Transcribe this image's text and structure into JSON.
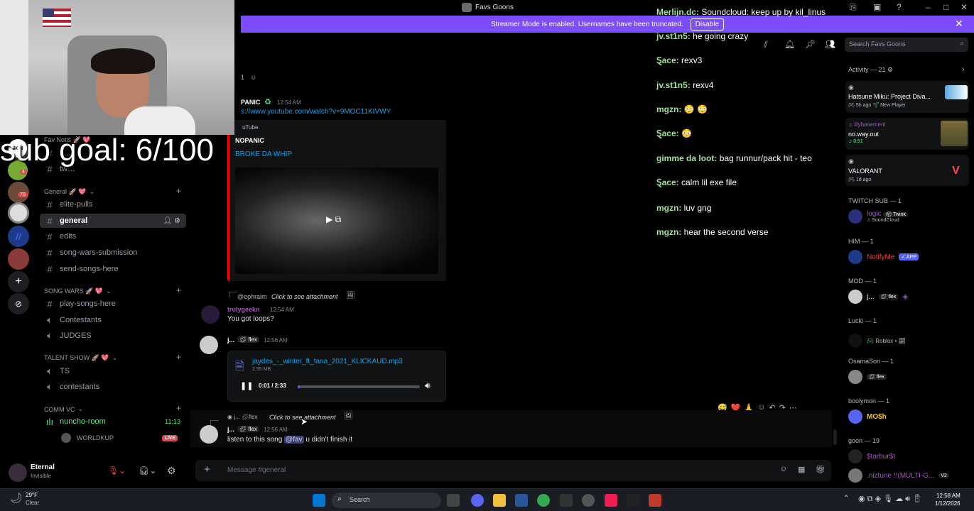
{
  "window": {
    "title": "Favs Goons"
  },
  "banner": {
    "text": "Streamer Mode is enabled. Usernames have been truncated.",
    "button": "Disable"
  },
  "overlay": {
    "sub_goal": "sub goal: 6/100",
    "flag_text": "CCN"
  },
  "server_badges": [
    "4",
    "70"
  ],
  "channels": {
    "fav_notis": "Fav Notis 🚀 💖",
    "fav_items": [
      "ti…",
      "tw…"
    ],
    "cat_general": "General 🚀 💖",
    "general": [
      "elite-pulls",
      "general",
      "edits",
      "song-wars-submission",
      "send-songs-here"
    ],
    "cat_song_wars": "SONG WARS 🚀 💖",
    "song_wars": [
      "play-songs-here",
      "Contestants",
      "JUDGES"
    ],
    "cat_talent": "TALENT SHOW 🚀 💖",
    "talent": [
      "TS",
      "contestants"
    ],
    "cat_comm": "Comm VC",
    "voice_room": "nuncho-room",
    "voice_time": "11:13",
    "voice_user": "WORLDKUP",
    "live_badge": "LIVE"
  },
  "user": {
    "name": "Eternal",
    "status": "Invisible"
  },
  "messages": {
    "reaction_count": "1",
    "m1_author": "PANIC",
    "m1_time": "12:54 AM",
    "m1_link": "s://www.youtube.com/watch?v=9MOC11KtVWY",
    "embed_provider": "uTube",
    "embed_author": "NOPANIC",
    "embed_title": "BROKE DA WHIP",
    "reply1_user": "@ephraim",
    "reply_click": "Click to see attachment",
    "m2_author": "trulygeekn",
    "m2_time": "12:54 AM",
    "m2_text": "You got loops?",
    "m3_author": "j...",
    "m3_tag": "flex",
    "m3_time": "12:56 AM",
    "file_name": "jaydes_-_winter_ft_tana_2021_KLICKAUD.mp3",
    "file_size": "2.55 MB",
    "audio_time": "0:01 / 2:33",
    "audio_progress": 0.02,
    "reply2_user": "j...",
    "reply2_tag": "flex",
    "m4_author": "j...",
    "m4_tag": "flex",
    "m4_time": "12:56 AM",
    "m4_text_a": "listen to this song",
    "m4_mention": "@fav",
    "m4_text_b": "u didn't finish it"
  },
  "composer": {
    "placeholder": "Message #general"
  },
  "header": {
    "search_placeholder": "Search Favs Goons"
  },
  "stream_chat": [
    {
      "user": "Merlijn.dc:",
      "text": "Soundcloud: keep up by kil_linus"
    },
    {
      "user": "jv.st1n5:",
      "text": "he going crazy"
    },
    {
      "user": "Ȿace:",
      "text": "rexv3"
    },
    {
      "user": "jv.st1n5:",
      "text": "rexv4"
    },
    {
      "user": "mgzn:",
      "text": "😳 😳"
    },
    {
      "user": "Ȿace:",
      "text": "😳"
    },
    {
      "user": "gimme da loot:",
      "text": "bag runnur/pack hit - teo"
    },
    {
      "user": "Ȿace:",
      "text": "calm lil exe file"
    },
    {
      "user": "mgzn:",
      "text": "luv gng"
    },
    {
      "user": "mgzn:",
      "text": "hear the second verse"
    }
  ],
  "sidebar": {
    "activity_title": "Activity — 21",
    "act1_title": "Hatsune Miku: Project Diva...",
    "act1_meta": "5h ago",
    "act1_tag": "New Player",
    "act2_user": "illybasement",
    "act2_title": "no.way.out",
    "act2_time": "0:51",
    "act3_title": "VALORANT",
    "act3_meta": "1d ago",
    "twitch_sub": "TWITCH SUB — 1",
    "m_logic": "logic",
    "m_logic_tag": "Twink",
    "m_logic_sub": "SoundCloud",
    "him": "HIM — 1",
    "m_notify": "NotifyMe",
    "app_badge": "APP",
    "mod": "MOD — 1",
    "m_mod": "j...",
    "m_mod_tag": "flex",
    "lucki": "Lucki — 1",
    "m_lucki_sub": "Roblox •",
    "osama": "OsamaSon — 1",
    "m_osama_tag": "flex",
    "boolymon": "boolymon — 1",
    "m_mosh": "MO$h",
    "goon": "goon — 19",
    "m_starbur": "$tarbur$t",
    "m_niztune": ".niztune !!(MULTI-G...",
    "m_v2": "V2"
  },
  "taskbar": {
    "weather_temp": "29°F",
    "weather_text": "Clear",
    "search": "Search",
    "time": "12:58 AM",
    "date": "1/12/2026"
  },
  "colors": {
    "accent": "#7c4dff",
    "link": "#00a8fc",
    "chat_name": "#9fe29b",
    "live": "#ed4245"
  }
}
